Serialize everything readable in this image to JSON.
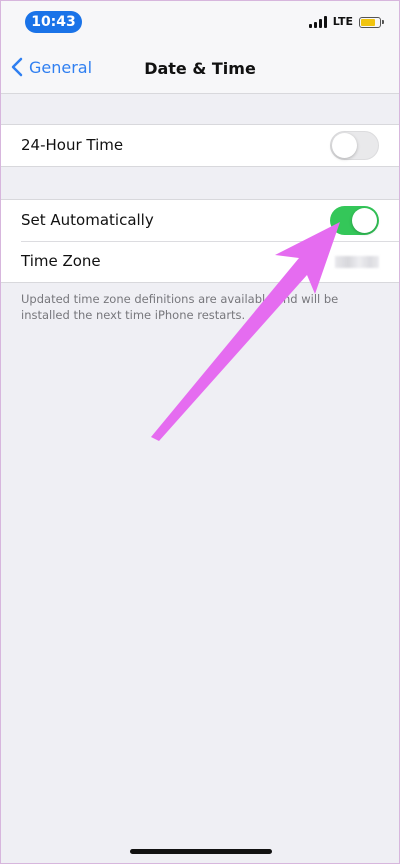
{
  "status_bar": {
    "time": "10:43",
    "network": "LTE",
    "icons": [
      "signal-icon",
      "battery-icon"
    ]
  },
  "nav": {
    "back_label": "General",
    "title": "Date & Time",
    "back_icon": "chevron-left-icon"
  },
  "settings": {
    "hour24": {
      "label": "24-Hour Time",
      "enabled": false
    },
    "set_automatically": {
      "label": "Set Automatically",
      "enabled": true
    },
    "time_zone": {
      "label": "Time Zone",
      "value_blurred": true
    }
  },
  "footnote": "Updated time zone definitions are available and will be installed the next time iPhone restarts.",
  "colors": {
    "accent": "#2f7ff1",
    "toggle_on": "#34c759",
    "toggle_off": "#e9e9eb",
    "annotation_arrow": "#e56cf0",
    "time_pill": "#1a73e8",
    "battery": "#f1c40f"
  },
  "annotation": {
    "type": "arrow",
    "target": "set-automatically-toggle"
  }
}
